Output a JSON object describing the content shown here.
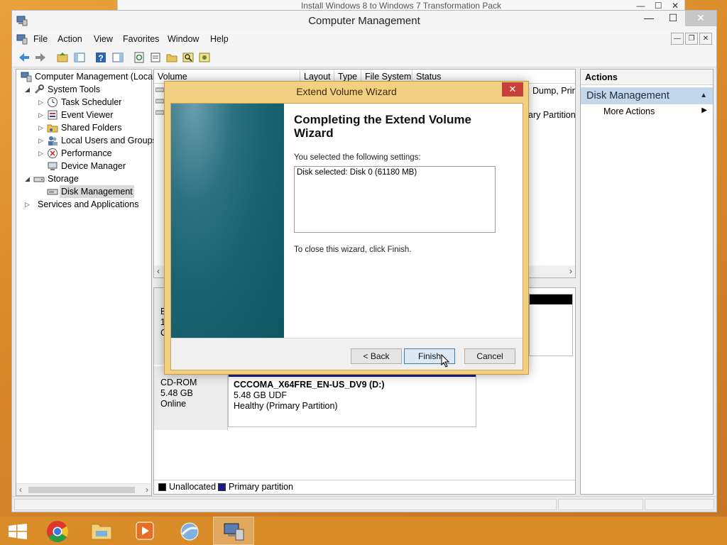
{
  "back_window": {
    "title": "Install Windows 8 to Windows 7 Transformation Pack",
    "buttons": [
      "—",
      "☐",
      "✕"
    ]
  },
  "window": {
    "title": "Computer Management",
    "buttons": {
      "minimize": "—",
      "maximize": "☐",
      "close": "✕"
    }
  },
  "menu": {
    "items": [
      "File",
      "Action",
      "View",
      "Favorites",
      "Window",
      "Help"
    ]
  },
  "mdi_buttons": [
    "—",
    "❐",
    "✕"
  ],
  "tree": {
    "items": [
      {
        "label": "Computer Management (Local",
        "icon": "computer-management-icon",
        "expander": ""
      },
      {
        "label": "System Tools",
        "icon": "system-tools-icon",
        "expander": "◢"
      },
      {
        "label": "Task Scheduler",
        "icon": "clock-icon",
        "expander": "▷"
      },
      {
        "label": "Event Viewer",
        "icon": "event-viewer-icon",
        "expander": "▷"
      },
      {
        "label": "Shared Folders",
        "icon": "shared-folder-icon",
        "expander": "▷"
      },
      {
        "label": "Local Users and Groups",
        "icon": "users-icon",
        "expander": "▷"
      },
      {
        "label": "Performance",
        "icon": "performance-icon",
        "expander": "▷"
      },
      {
        "label": "Device Manager",
        "icon": "device-manager-icon",
        "expander": ""
      },
      {
        "label": "Storage",
        "icon": "storage-icon",
        "expander": "◢"
      },
      {
        "label": "Disk Management",
        "icon": "disk-icon",
        "expander": ""
      },
      {
        "label": "Services and Applications",
        "icon": "services-icon",
        "expander": "▷"
      }
    ]
  },
  "volume_list": {
    "columns": [
      "Volume",
      "Layout",
      "Type",
      "File System",
      "Status"
    ],
    "rows": [
      "Dump, Prin",
      "ary Partition)"
    ]
  },
  "disk_view": {
    "disk0": {
      "lines": [
        "B",
        "1",
        "C"
      ]
    },
    "cdrom": {
      "name": "CD-ROM",
      "size": "5.48 GB",
      "state": "Online",
      "partition": {
        "title": "CCCOMA_X64FRE_EN-US_DV9  (D:)",
        "size": "5.48 GB UDF",
        "status": "Healthy (Primary Partition)"
      }
    },
    "legend": [
      {
        "label": "Unallocated",
        "color": "#000000"
      },
      {
        "label": "Primary partition",
        "color": "#1a1a8c"
      }
    ]
  },
  "actions": {
    "header": "Actions",
    "section": "Disk Management",
    "section_arrow": "▲",
    "items": [
      {
        "label": "More Actions",
        "arrow": "▶"
      }
    ]
  },
  "wizard": {
    "title": "Extend Volume Wizard",
    "close": "✕",
    "heading": "Completing the Extend Volume Wizard",
    "settings_intro": "You selected the following settings:",
    "settings": "Disk selected: Disk 0 (61180 MB)",
    "close_hint": "To close this wizard, click Finish.",
    "back_label": "< Back",
    "finish_label": "Finish",
    "cancel_label": "Cancel"
  },
  "taskbar": {
    "items": [
      {
        "name": "start-button"
      },
      {
        "name": "chrome-icon"
      },
      {
        "name": "file-explorer-icon"
      },
      {
        "name": "media-player-icon"
      },
      {
        "name": "setup-icon"
      },
      {
        "name": "computer-management-icon",
        "active": true
      }
    ]
  },
  "colors": {
    "accent": "#c2d6ec",
    "wizard_frame": "#f3cf82",
    "desktop": "#d98a2a",
    "close_red": "#c7413a"
  }
}
